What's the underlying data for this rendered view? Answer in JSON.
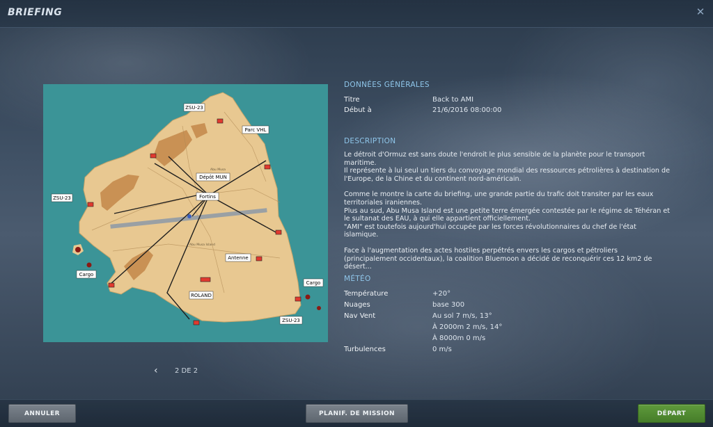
{
  "header": {
    "title": "BRIEFING",
    "close_icon": "close-icon"
  },
  "map": {
    "labels": [
      "ZSU-23",
      "Parc VHL",
      "Dépôt MUN",
      "Fortins",
      "ZSU-23",
      "Cargo",
      "Antenne",
      "ROLAND",
      "Cargo",
      "ZSU-23"
    ],
    "small_labels": [
      "Abu Musa",
      "Abu Musa Island"
    ],
    "colors": {
      "sea": "#3b9497",
      "land": "#e8c891",
      "urban": "#c58b4e",
      "runway": "#9aa0a4"
    }
  },
  "pager": {
    "prev_icon": "chevron-left-icon",
    "text": "2 DE 2"
  },
  "general": {
    "heading": "DONNÉES GÉNÉRALES",
    "rows": [
      {
        "label": "Titre",
        "value": "Back to AMI"
      },
      {
        "label": "Début à",
        "value": "21/6/2016  08:00:00"
      }
    ]
  },
  "description": {
    "heading": "DESCRIPTION",
    "paragraphs": [
      "Le détroit d'Ormuz est sans doute l'endroit le plus sensible de la planète pour le transport maritime.\nIl représente à lui seul un tiers du convoyage mondial des ressources pétrolières à destination de l'Europe, de la Chine et du continent nord-américain.",
      "Comme le montre la carte du briefing, une grande partie du trafic doit transiter par les eaux territoriales iraniennes.\nPlus au sud, Abu Musa Island est une petite terre émergée contestée par le régime de Téhéran et le sultanat des EAU, à qui elle appartient officiellement.\n\"AMI\" est toutefois aujourd'hui occupée par les forces révolutionnaires du chef de l'état islamique.",
      "Face à l'augmentation des actes hostiles perpétrés envers les cargos et pétroliers (principalement occidentaux), la coalition Bluemoon a décidé de reconquérir ces 12 km2 de désert..."
    ]
  },
  "weather": {
    "heading": "MÉTÉO",
    "temperature": {
      "label": "Température",
      "value": "+20°"
    },
    "clouds": {
      "label": "Nuages",
      "value": "base 300"
    },
    "wind": {
      "label": "Nav Vent",
      "values": [
        "Au sol 7 m/s, 13°",
        "À 2000m 2 m/s, 14°",
        "À 8000m 0 m/s"
      ]
    },
    "turbulence": {
      "label": "Turbulences",
      "value": "0 m/s"
    }
  },
  "footer": {
    "cancel": "ANNULER",
    "plan": "PLANIF. DE MISSION",
    "start": "DÉPART"
  }
}
